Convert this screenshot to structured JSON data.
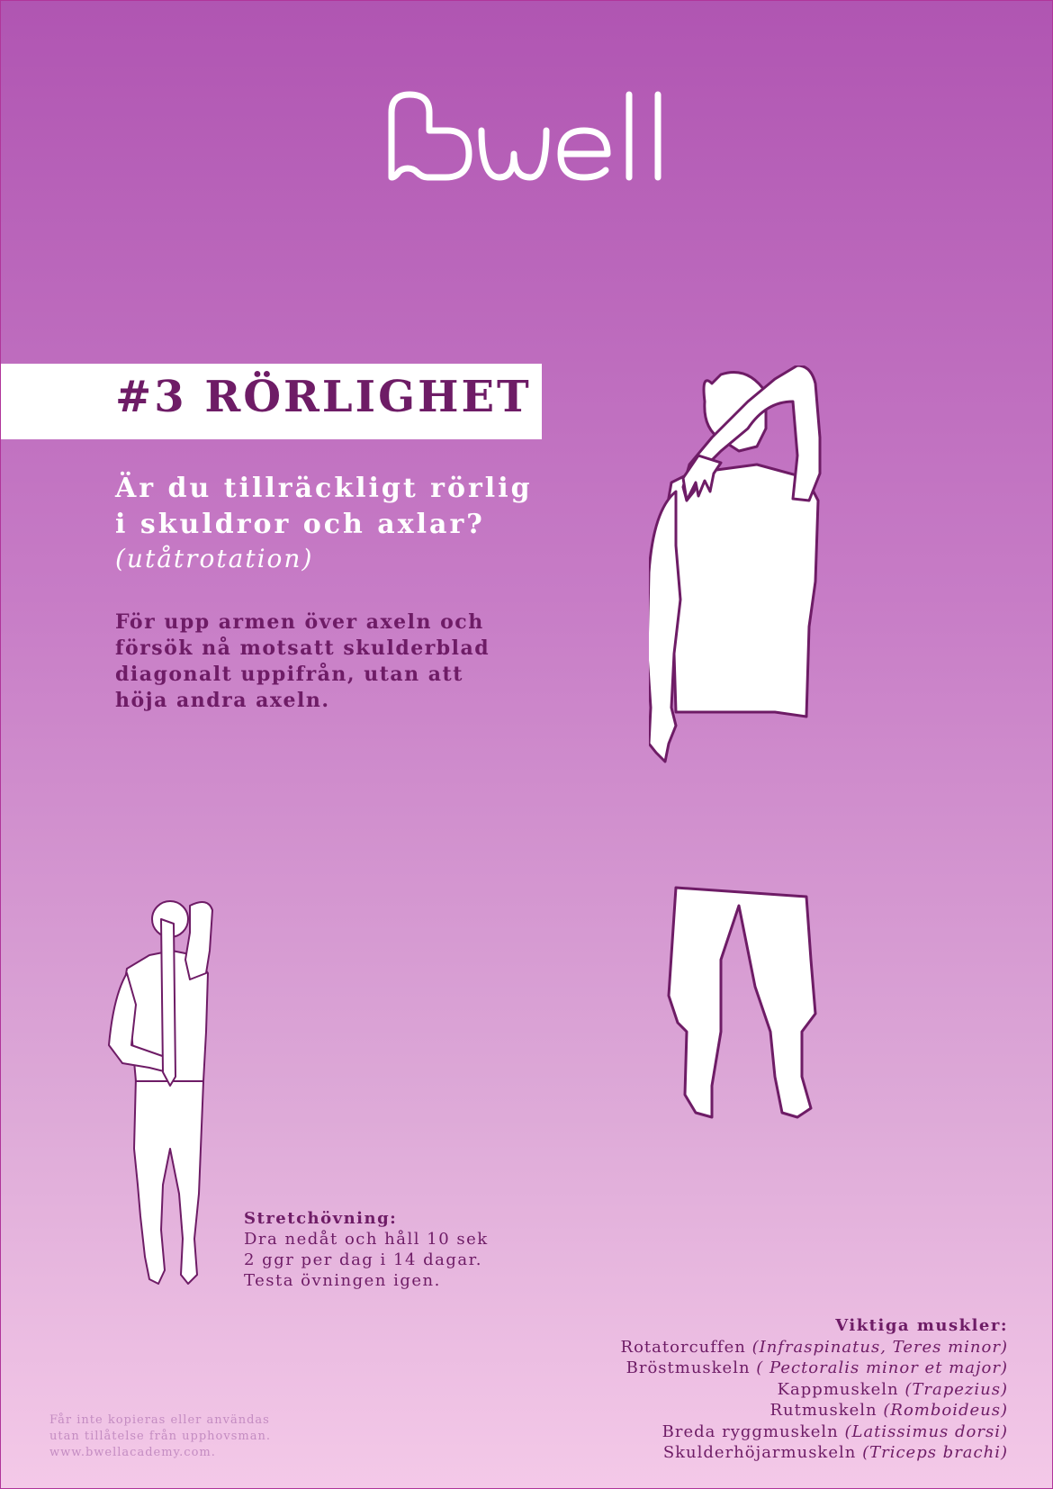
{
  "brand": {
    "logo_text": "Bwell"
  },
  "poster": {
    "title": "#3 RÖRLIGHET",
    "question_lines": [
      "Är du tillräckligt rörlig",
      "i skuldror och axlar?"
    ],
    "subtitle": "(utåtrotation)",
    "instruction_lines": [
      "För upp armen över axeln och",
      "försök nå motsatt skulderblad",
      "diagonalt uppifrån, utan att",
      "höja andra axeln."
    ]
  },
  "stretch": {
    "heading": "Stretchövning:",
    "lines": [
      "Dra nedåt och håll 10 sek",
      "2 ggr per dag i 14 dagar.",
      "Testa övningen igen."
    ]
  },
  "muscles": {
    "heading": "Viktiga muskler:",
    "items": [
      {
        "name": "Rotatorcuffen",
        "latin": "(Infraspinatus, Teres minor)"
      },
      {
        "name": "Bröstmuskeln",
        "latin": "( Pectoralis minor et major)"
      },
      {
        "name": "Kappmuskeln",
        "latin": "(Trapezius)"
      },
      {
        "name": "Rutmuskeln",
        "latin": "(Romboideus)"
      },
      {
        "name": "Breda ryggmuskeln",
        "latin": "(Latissimus dorsi)"
      },
      {
        "name": "Skulderhöjarmuskeln",
        "latin": "(Triceps brachi)"
      }
    ]
  },
  "footer": {
    "lines": [
      "Får inte kopieras eller användas",
      "utan tillåtelse från upphovsman.",
      "www.bwellacademy.com."
    ]
  },
  "colors": {
    "gradient_top": "#b055b2",
    "gradient_bottom": "#f4c9e8",
    "accent_dark": "#6e1c66",
    "white": "#ffffff"
  }
}
